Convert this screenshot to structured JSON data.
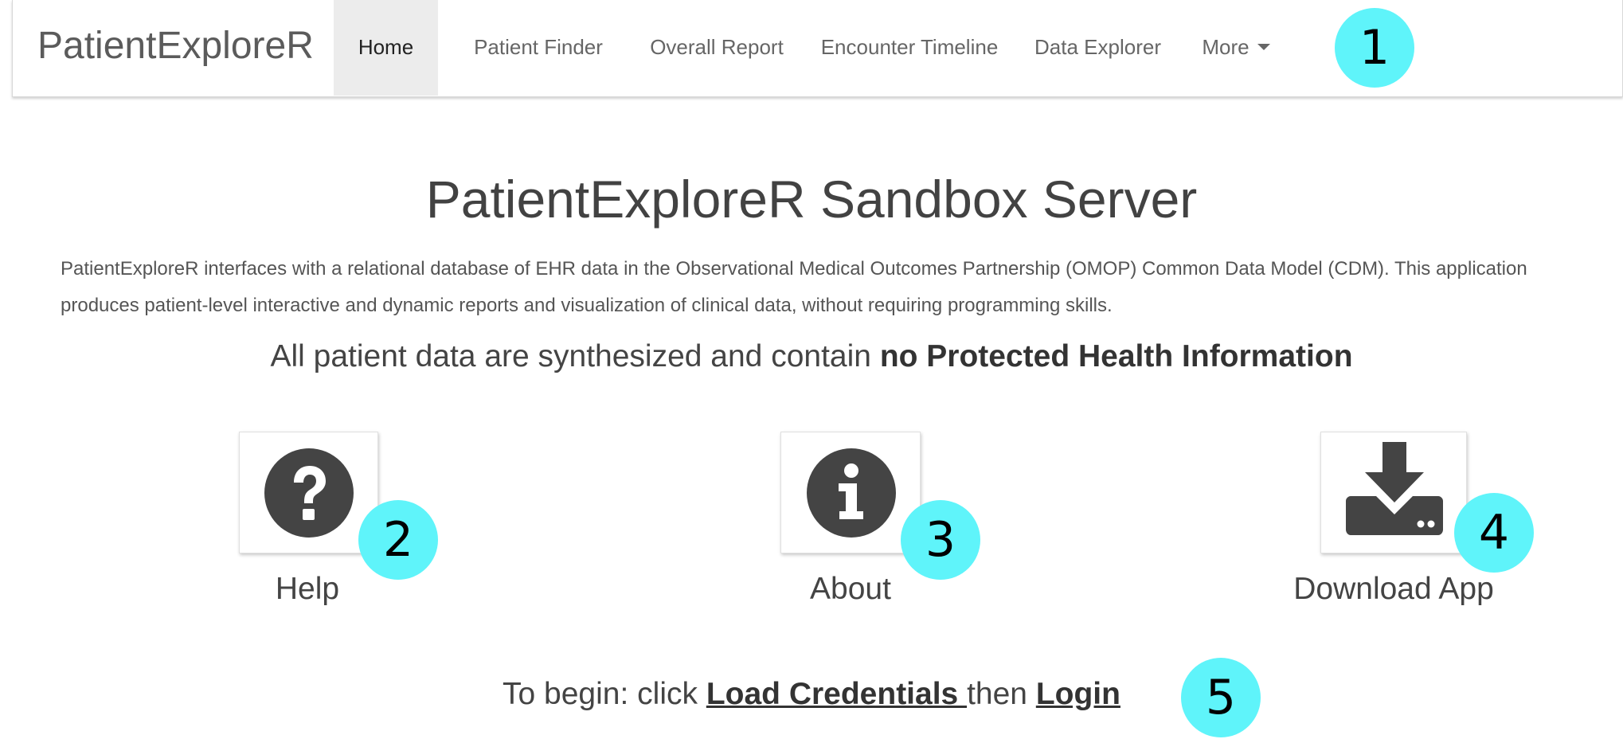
{
  "navbar": {
    "brand": "PatientExploreR",
    "items": [
      {
        "label": "Home",
        "active": true
      },
      {
        "label": "Patient Finder"
      },
      {
        "label": "Overall Report"
      },
      {
        "label": "Encounter Timeline"
      },
      {
        "label": "Data Explorer"
      },
      {
        "label": "More"
      }
    ]
  },
  "badges": [
    "1",
    "2",
    "3",
    "4",
    "5"
  ],
  "main": {
    "title": "PatientExploreR Sandbox Server",
    "intro": "PatientExploreR interfaces with a relational database of EHR data in the Observational Medical Outcomes Partnership (OMOP) Common Data Model (CDM). This application produces patient-level interactive and dynamic reports and visualization of clinical data, without requiring programming skills.",
    "notice_prefix": "All patient data are synthesized and contain ",
    "notice_bold": "no Protected Health Information",
    "tiles": [
      {
        "label": "Help",
        "icon": "question-circle-icon"
      },
      {
        "label": "About",
        "icon": "info-circle-icon"
      },
      {
        "label": "Download App",
        "icon": "download-icon"
      }
    ],
    "begin_prefix": "To begin: click ",
    "begin_link1": "Load Credentials ",
    "begin_middle": "then ",
    "begin_link2": "Login"
  },
  "colors": {
    "badge": "#5ff4fa",
    "icon": "#444444",
    "active_tab": "#ececec"
  }
}
